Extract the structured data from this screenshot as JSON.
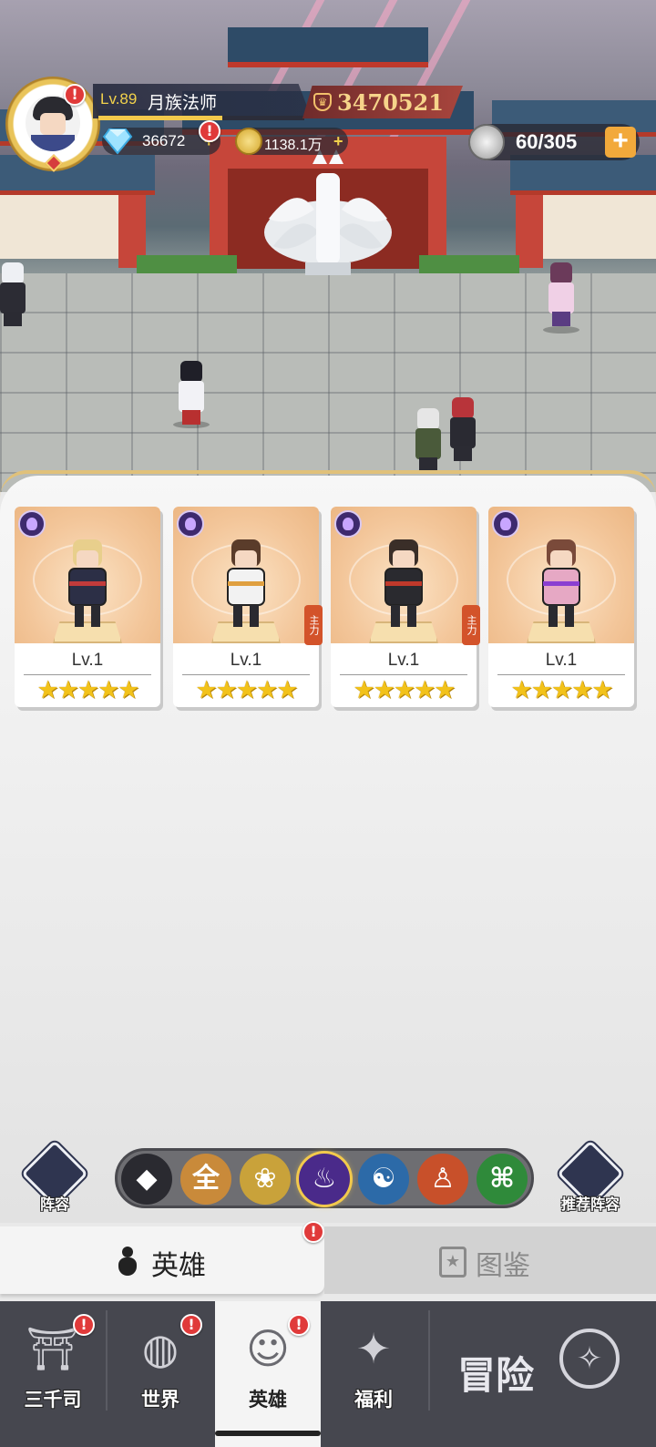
{
  "player": {
    "level": "Lv.89",
    "name": "月族法师",
    "power": "3470521",
    "exp_fraction": 0.6
  },
  "resources": {
    "diamonds": "36672",
    "gold": "1138.1万",
    "stamina": "60/305",
    "add_symbol": "+"
  },
  "heroes": [
    {
      "level": "Lv.1",
      "stars": "★★★★★",
      "role_tag": "",
      "hair": "#e8cf8c",
      "outfit": "#2c2f46",
      "accent": "#c23b3b"
    },
    {
      "level": "Lv.1",
      "stars": "★★★★★",
      "role_tag": "主力",
      "hair": "#5a3c2a",
      "outfit": "#f2f2f2",
      "accent": "#e0a040"
    },
    {
      "level": "Lv.1",
      "stars": "★★★★★",
      "role_tag": "主力",
      "hair": "#3a2e28",
      "outfit": "#2a2a2f",
      "accent": "#c0392b"
    },
    {
      "level": "Lv.1",
      "stars": "★★★★★",
      "role_tag": "",
      "hair": "#7a4a3a",
      "outfit": "#e6a8c4",
      "accent": "#8a3fd1"
    }
  ],
  "filters": {
    "lineup_label": "阵容",
    "recommend_label": "推荐阵容",
    "items": [
      {
        "name": "filter-all-icon",
        "glyph": "◆",
        "color": "#2a2a30"
      },
      {
        "name": "filter-universal",
        "glyph": "全",
        "color": "#c98a3a"
      },
      {
        "name": "filter-lotus-icon",
        "glyph": "❀",
        "color": "#c9a23a"
      },
      {
        "name": "filter-flame-icon",
        "glyph": "♨",
        "color": "#4a2a8a"
      },
      {
        "name": "filter-yinyang-icon",
        "glyph": "☯",
        "color": "#2c6aa8"
      },
      {
        "name": "filter-meditation-icon",
        "glyph": "♙",
        "color": "#c8502a"
      },
      {
        "name": "filter-dna-icon",
        "glyph": "⌘",
        "color": "#2f8a3a"
      }
    ]
  },
  "tabs": {
    "hero": "英雄",
    "codex": "图鉴"
  },
  "nav": {
    "sanqiansi": "三千司",
    "world": "世界",
    "hero": "英雄",
    "welfare": "福利",
    "adventure": "冒险"
  },
  "alert_symbol": "!",
  "colors": {
    "accent_gold": "#f2c94c",
    "alert_red": "#e03a3a",
    "nav_bg": "#46474f"
  }
}
